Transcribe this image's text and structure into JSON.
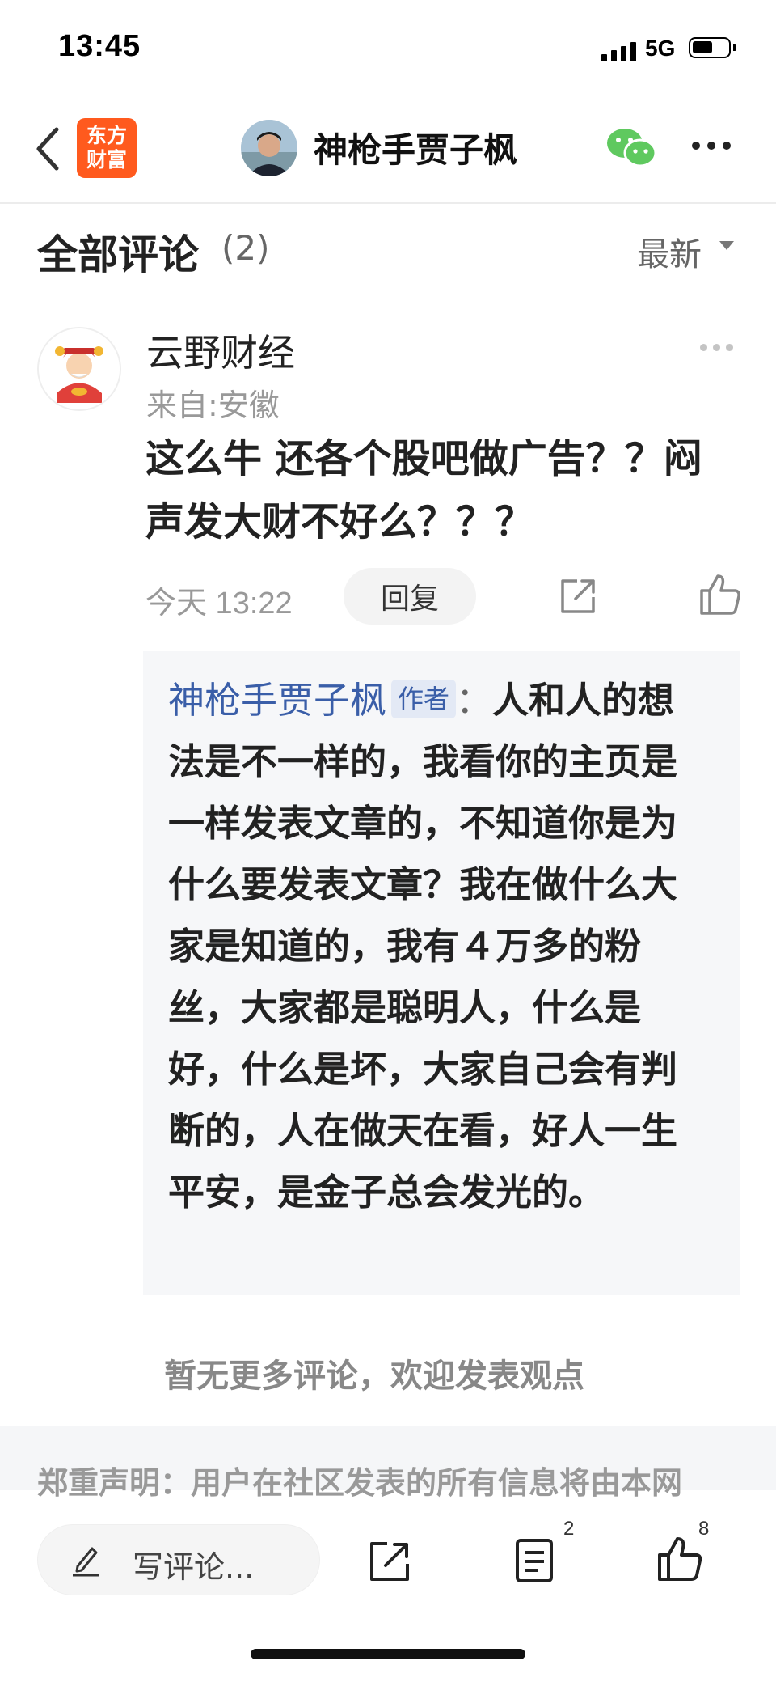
{
  "status_bar": {
    "time": "13:45",
    "network": "5G"
  },
  "nav": {
    "logo_line1": "东方",
    "logo_line2": "财富",
    "title": "神枪手贾子枫"
  },
  "comments_header": {
    "title": "全部评论",
    "count": "(2)",
    "sort_label": "最新"
  },
  "comment": {
    "user": "云野财经",
    "location": "来自:安徽",
    "text": "这么牛 还各个股吧做广告？？闷声发大财不好么？？？",
    "time": "今天 13:22",
    "reply_button": "回复"
  },
  "author_reply": {
    "name": "神枪手贾子枫",
    "badge": "作者",
    "colon": "：",
    "text": "人和人的想法是不一样的，我看你的主页是一样发表文章的，不知道你是为什么要发表文章？我在做什么大家是知道的，我有４万多的粉丝，大家都是聪明人，什么是好，什么是坏，大家自己会有判断的，人在做天在看，好人一生平安，是金子总会发光的。"
  },
  "no_more_text": "暂无更多评论，欢迎发表观点",
  "disclaimer": "郑重声明：用户在社区发表的所有信息将由本网",
  "toolbar": {
    "write_placeholder": "写评论...",
    "comment_count": "2",
    "like_count": "8"
  },
  "colors": {
    "brand_orange": "#ff5a1e",
    "author_blue": "#3a5ea8",
    "wechat_green": "#5fc95f"
  },
  "icons": [
    "back-icon",
    "wechat-icon",
    "more-icon",
    "share-icon",
    "like-icon",
    "edit-icon",
    "list-icon"
  ]
}
